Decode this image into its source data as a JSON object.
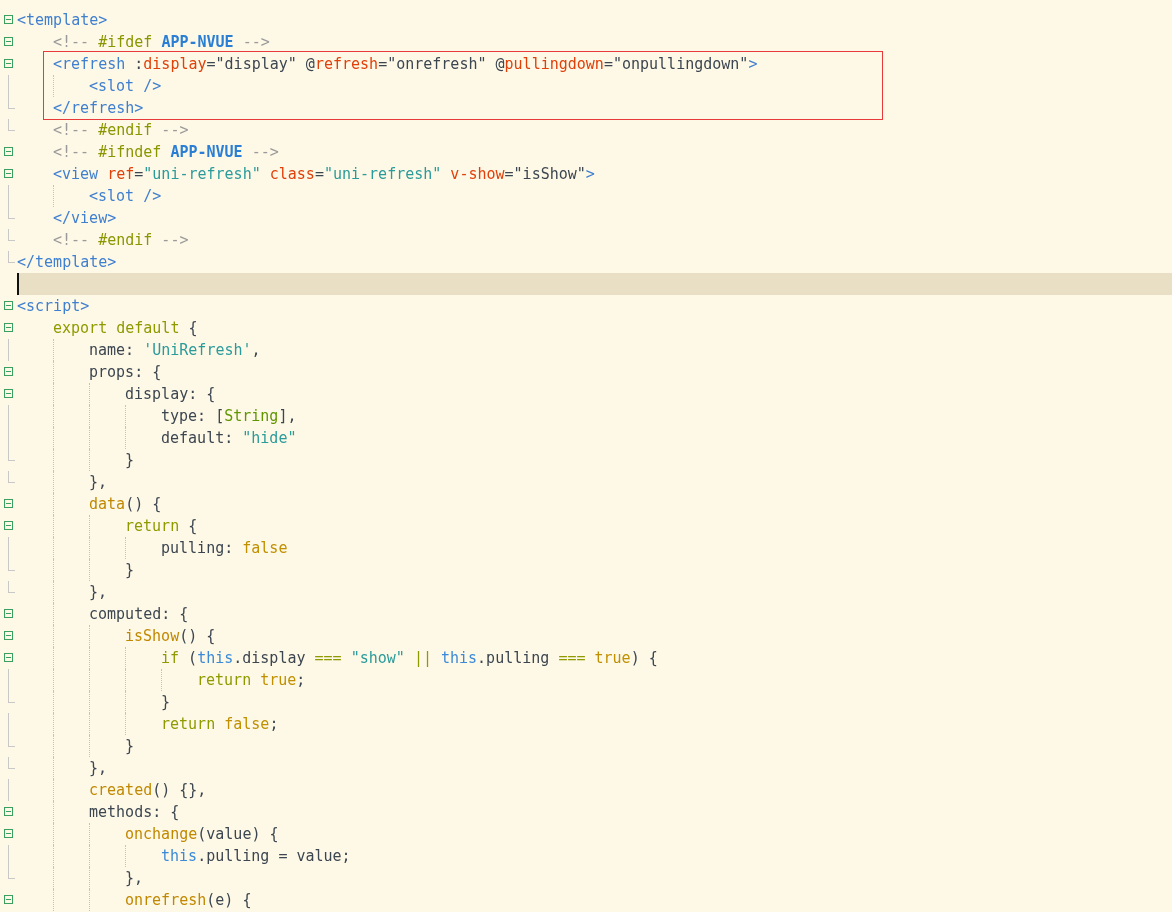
{
  "editor": {
    "lines": [
      {
        "kind": "block",
        "open": [
          {
            "kind": "tag",
            "text": "<template>"
          }
        ],
        "children": [
          {
            "kind": "region",
            "open": [
              {
                "kind": "comment",
                "text": "<!-- "
              },
              {
                "kind": "macro",
                "text": "#ifdef "
              },
              {
                "kind": "define",
                "text": "APP-NVUE"
              },
              {
                "kind": "comment",
                "text": " -->"
              }
            ],
            "children": [
              {
                "kind": "block",
                "boxed": true,
                "open": [
                  {
                    "kind": "tag",
                    "text": "<refresh "
                  },
                  {
                    "kind": "plain",
                    "text": ":"
                  },
                  {
                    "kind": "attr",
                    "text": "display"
                  },
                  {
                    "kind": "plain",
                    "text": "=\"display\" @"
                  },
                  {
                    "kind": "attr",
                    "text": "refresh"
                  },
                  {
                    "kind": "plain",
                    "text": "=\"onrefresh\" @"
                  },
                  {
                    "kind": "attr",
                    "text": "pullingdown"
                  },
                  {
                    "kind": "plain",
                    "text": "=\"onpullingdown\""
                  },
                  {
                    "kind": "tag",
                    "text": ">"
                  }
                ],
                "children": [
                  {
                    "kind": "line",
                    "tokens": [
                      {
                        "kind": "tag",
                        "text": "<slot />"
                      }
                    ]
                  }
                ],
                "close": [
                  {
                    "kind": "tag",
                    "text": "</refresh>"
                  }
                ]
              }
            ],
            "close": [
              {
                "kind": "comment",
                "text": "<!-- "
              },
              {
                "kind": "macro",
                "text": "#endif"
              },
              {
                "kind": "comment",
                "text": " -->"
              }
            ]
          },
          {
            "kind": "region",
            "open": [
              {
                "kind": "comment",
                "text": "<!-- "
              },
              {
                "kind": "macro",
                "text": "#ifndef "
              },
              {
                "kind": "define",
                "text": "APP-NVUE"
              },
              {
                "kind": "comment",
                "text": " -->"
              }
            ],
            "children": [
              {
                "kind": "block",
                "open": [
                  {
                    "kind": "tag",
                    "text": "<view "
                  },
                  {
                    "kind": "attr",
                    "text": "ref"
                  },
                  {
                    "kind": "plain",
                    "text": "="
                  },
                  {
                    "kind": "string",
                    "text": "\"uni-refresh\""
                  },
                  {
                    "kind": "attr",
                    "text": " class"
                  },
                  {
                    "kind": "plain",
                    "text": "="
                  },
                  {
                    "kind": "string",
                    "text": "\"uni-refresh\""
                  },
                  {
                    "kind": "attr",
                    "text": " v-show"
                  },
                  {
                    "kind": "plain",
                    "text": "=\"isShow\""
                  },
                  {
                    "kind": "tag",
                    "text": ">"
                  }
                ],
                "children": [
                  {
                    "kind": "line",
                    "tokens": [
                      {
                        "kind": "tag",
                        "text": "<slot />"
                      }
                    ]
                  }
                ],
                "close": [
                  {
                    "kind": "tag",
                    "text": "</view>"
                  }
                ]
              }
            ],
            "close": [
              {
                "kind": "comment",
                "text": "<!-- "
              },
              {
                "kind": "macro",
                "text": "#endif"
              },
              {
                "kind": "comment",
                "text": " -->"
              }
            ]
          }
        ],
        "close": [
          {
            "kind": "tag",
            "text": "</template>"
          }
        ]
      },
      {
        "kind": "blank",
        "current": true
      },
      {
        "kind": "block",
        "open": [
          {
            "kind": "tag",
            "text": "<script>"
          }
        ],
        "children": [
          {
            "kind": "block",
            "open": [
              {
                "kind": "keyword",
                "text": "export default"
              },
              {
                "kind": "plain",
                "text": " {"
              }
            ],
            "children": [
              {
                "kind": "line",
                "tokens": [
                  {
                    "kind": "plain",
                    "text": "name: "
                  },
                  {
                    "kind": "string",
                    "text": "'UniRefresh'"
                  },
                  {
                    "kind": "plain",
                    "text": ","
                  }
                ]
              },
              {
                "kind": "block",
                "open": [
                  {
                    "kind": "plain",
                    "text": "props: {"
                  }
                ],
                "children": [
                  {
                    "kind": "block",
                    "open": [
                      {
                        "kind": "plain",
                        "text": "display: {"
                      }
                    ],
                    "children": [
                      {
                        "kind": "line",
                        "tokens": [
                          {
                            "kind": "plain",
                            "text": "type: ["
                          },
                          {
                            "kind": "type",
                            "text": "String"
                          },
                          {
                            "kind": "plain",
                            "text": "],"
                          }
                        ]
                      },
                      {
                        "kind": "line",
                        "tokens": [
                          {
                            "kind": "plain",
                            "text": "default: "
                          },
                          {
                            "kind": "string",
                            "text": "\"hide\""
                          }
                        ]
                      }
                    ],
                    "close": [
                      {
                        "kind": "plain",
                        "text": "}"
                      }
                    ]
                  }
                ],
                "close": [
                  {
                    "kind": "plain",
                    "text": "},"
                  }
                ]
              },
              {
                "kind": "block",
                "open": [
                  {
                    "kind": "func",
                    "text": "data"
                  },
                  {
                    "kind": "plain",
                    "text": "() {"
                  }
                ],
                "children": [
                  {
                    "kind": "block",
                    "open": [
                      {
                        "kind": "keyword",
                        "text": "return"
                      },
                      {
                        "kind": "plain",
                        "text": " {"
                      }
                    ],
                    "children": [
                      {
                        "kind": "line",
                        "tokens": [
                          {
                            "kind": "plain",
                            "text": "pulling: "
                          },
                          {
                            "kind": "literal",
                            "text": "false"
                          }
                        ]
                      }
                    ],
                    "close": [
                      {
                        "kind": "plain",
                        "text": "}"
                      }
                    ]
                  }
                ],
                "close": [
                  {
                    "kind": "plain",
                    "text": "},"
                  }
                ]
              },
              {
                "kind": "block",
                "open": [
                  {
                    "kind": "plain",
                    "text": "computed: {"
                  }
                ],
                "children": [
                  {
                    "kind": "block",
                    "open": [
                      {
                        "kind": "func",
                        "text": "isShow"
                      },
                      {
                        "kind": "plain",
                        "text": "() {"
                      }
                    ],
                    "children": [
                      {
                        "kind": "block",
                        "open": [
                          {
                            "kind": "keyword",
                            "text": "if"
                          },
                          {
                            "kind": "plain",
                            "text": " ("
                          },
                          {
                            "kind": "this",
                            "text": "this"
                          },
                          {
                            "kind": "plain",
                            "text": ".display "
                          },
                          {
                            "kind": "keyword",
                            "text": "==="
                          },
                          {
                            "kind": "string",
                            "text": " \"show\" "
                          },
                          {
                            "kind": "keyword",
                            "text": "||"
                          },
                          {
                            "kind": "this",
                            "text": " this"
                          },
                          {
                            "kind": "plain",
                            "text": ".pulling "
                          },
                          {
                            "kind": "keyword",
                            "text": "==="
                          },
                          {
                            "kind": "literal",
                            "text": " true"
                          },
                          {
                            "kind": "plain",
                            "text": ") {"
                          }
                        ],
                        "children": [
                          {
                            "kind": "line",
                            "tokens": [
                              {
                                "kind": "keyword",
                                "text": "return"
                              },
                              {
                                "kind": "literal",
                                "text": " true"
                              },
                              {
                                "kind": "plain",
                                "text": ";"
                              }
                            ]
                          }
                        ],
                        "close": [
                          {
                            "kind": "plain",
                            "text": "}"
                          }
                        ]
                      },
                      {
                        "kind": "line",
                        "tokens": [
                          {
                            "kind": "keyword",
                            "text": "return"
                          },
                          {
                            "kind": "literal",
                            "text": " false"
                          },
                          {
                            "kind": "plain",
                            "text": ";"
                          }
                        ]
                      }
                    ],
                    "close": [
                      {
                        "kind": "plain",
                        "text": "}"
                      }
                    ]
                  }
                ],
                "close": [
                  {
                    "kind": "plain",
                    "text": "},"
                  }
                ]
              },
              {
                "kind": "line",
                "tokens": [
                  {
                    "kind": "func",
                    "text": "created"
                  },
                  {
                    "kind": "plain",
                    "text": "() {},"
                  }
                ]
              },
              {
                "kind": "block",
                "open": [
                  {
                    "kind": "plain",
                    "text": "methods: {"
                  }
                ],
                "children": [
                  {
                    "kind": "block",
                    "open": [
                      {
                        "kind": "func",
                        "text": "onchange"
                      },
                      {
                        "kind": "plain",
                        "text": "(value) {"
                      }
                    ],
                    "children": [
                      {
                        "kind": "line",
                        "tokens": [
                          {
                            "kind": "this",
                            "text": "this"
                          },
                          {
                            "kind": "plain",
                            "text": ".pulling = value;"
                          }
                        ]
                      }
                    ],
                    "close": [
                      {
                        "kind": "plain",
                        "text": "},"
                      }
                    ]
                  },
                  {
                    "kind": "block",
                    "open": [
                      {
                        "kind": "func",
                        "text": "onrefresh"
                      },
                      {
                        "kind": "plain",
                        "text": "(e) {"
                      }
                    ]
                  }
                ]
              }
            ]
          }
        ]
      }
    ]
  }
}
